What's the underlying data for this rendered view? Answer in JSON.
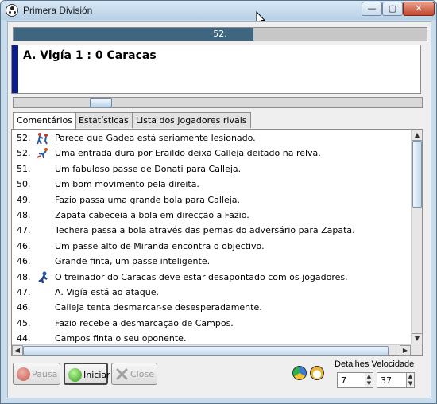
{
  "window": {
    "title": "Primera División",
    "min_glyph": "—",
    "max_glyph": "▢",
    "close_glyph": "✕"
  },
  "match": {
    "progress_label": "52.",
    "progress_fraction": 0.58,
    "score": "A. Vigía 1 : 0 Caracas"
  },
  "tabs": [
    {
      "label": "Comentários",
      "active": true
    },
    {
      "label": "Estatísticas",
      "active": false
    },
    {
      "label": "Lista dos jogadores rivais",
      "active": false
    }
  ],
  "commentary": [
    {
      "minute": "52.",
      "icon": "injury-icon",
      "text": "Parece que Gadea está seriamente lesionado."
    },
    {
      "minute": "52.",
      "icon": "foul-icon",
      "text": "Uma entrada dura por Eraildo deixa Calleja deitado na relva."
    },
    {
      "minute": "51.",
      "icon": "",
      "text": "Um fabuloso passe de Donati para Calleja."
    },
    {
      "minute": "50.",
      "icon": "",
      "text": "Um bom movimento pela direita."
    },
    {
      "minute": "49.",
      "icon": "",
      "text": "Fazio passa uma grande bola para Calleja."
    },
    {
      "minute": "48.",
      "icon": "",
      "text": "Zapata cabeceia a bola em direcção a Fazio."
    },
    {
      "minute": "47.",
      "icon": "",
      "text": "Techera passa a bola através das pernas do adversário para Zapata."
    },
    {
      "minute": "46.",
      "icon": "",
      "text": "Um passe alto de Miranda encontra o objectivo."
    },
    {
      "minute": "46.",
      "icon": "",
      "text": "Grande finta, um passe inteligente."
    },
    {
      "minute": "48.",
      "icon": "coach-icon",
      "text": "O treinador do Caracas deve estar desapontado com os jogadores."
    },
    {
      "minute": "47.",
      "icon": "",
      "text": "A. Vigía está ao ataque."
    },
    {
      "minute": "46.",
      "icon": "",
      "text": "Calleja tenta desmarcar-se desesperadamente."
    },
    {
      "minute": "45.",
      "icon": "",
      "text": "Fazio recebe a desmarcação de Campos."
    },
    {
      "minute": "44.",
      "icon": "",
      "text": "Campos finta o seu oponente."
    }
  ],
  "buttons": {
    "pause": "Pausa",
    "start": "Iniciar",
    "close": "Close"
  },
  "settings": {
    "label": "Detalhes Velocidade",
    "details_value": "7",
    "speed_value": "37"
  },
  "colors": {
    "score_accent": "#0a1e8c",
    "progress_fill": "#3e6680"
  }
}
